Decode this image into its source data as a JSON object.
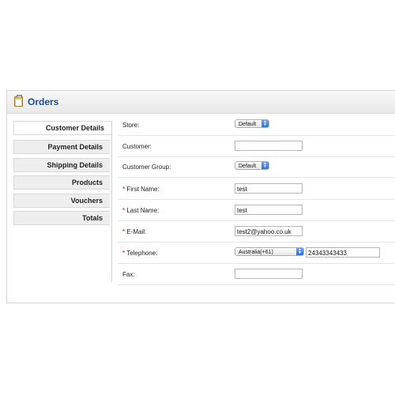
{
  "header": {
    "title": "Orders",
    "icon": "clipboard-icon"
  },
  "tabs": [
    {
      "label": "Customer Details",
      "active": true
    },
    {
      "label": "Payment Details"
    },
    {
      "label": "Shipping Details"
    },
    {
      "label": "Products"
    },
    {
      "label": "Vouchers"
    },
    {
      "label": "Totals"
    }
  ],
  "form": {
    "store": {
      "label": "Store:",
      "value": "Default"
    },
    "customer": {
      "label": "Customer:",
      "value": ""
    },
    "customer_group": {
      "label": "Customer Group:",
      "value": "Default"
    },
    "first_name": {
      "label": "First Name:",
      "required": "*",
      "value": "test"
    },
    "last_name": {
      "label": "Last Name:",
      "required": "*",
      "value": "test"
    },
    "email": {
      "label": "E-Mail:",
      "required": "*",
      "value": "test2@yahoo.co.uk"
    },
    "telephone": {
      "label": "Telephone:",
      "required": "*",
      "country": "Australia(+61)",
      "value": "24343343433"
    },
    "fax": {
      "label": "Fax:",
      "value": ""
    }
  },
  "colors": {
    "title": "#1b4c93",
    "required": "#cc0000",
    "select_accent": "#2f73e0"
  }
}
